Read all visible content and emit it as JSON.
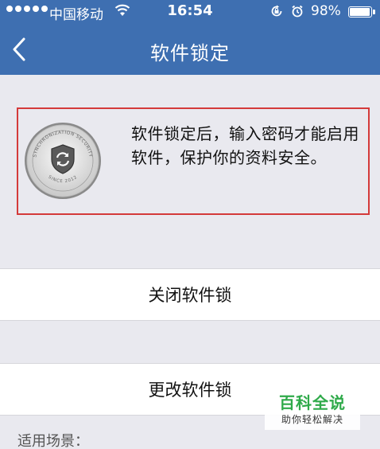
{
  "status_bar": {
    "carrier": "中国移动",
    "time": "16:54",
    "battery_percent": "98%",
    "battery_level": 0.98,
    "icons": [
      "signal-dots",
      "wifi-icon",
      "rotation-lock-icon",
      "alarm-icon",
      "battery-icon"
    ]
  },
  "nav": {
    "title": "软件锁定",
    "back_icon": "chevron-left-icon"
  },
  "info": {
    "text": "软件锁定后，输入密码才能启用软件，保护你的资料安全。",
    "badge_ring_text": "SYNCHRONIZATION SECURITY",
    "badge_bottom_text": "SINCE 2012",
    "highlight_color": "#d43a3a"
  },
  "actions": {
    "close_lock": "关闭软件锁",
    "change_lock": "更改软件锁"
  },
  "section": {
    "scene_label": "适用场景："
  },
  "watermark": {
    "title": "百科全说",
    "subtitle": "助你轻松解决"
  },
  "colors": {
    "nav_bg": "#3e6fb1",
    "page_bg": "#e9e9ef",
    "watermark_green": "#2faa4a"
  }
}
